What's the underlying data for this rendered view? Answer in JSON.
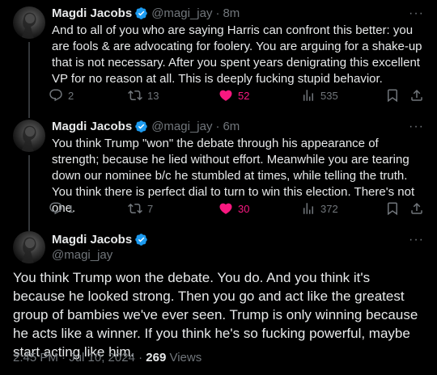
{
  "colors": {
    "background": "#000000",
    "text": "#e7e9ea",
    "muted": "#71767b",
    "verified": "#1d9bf0",
    "like": "#f91880"
  },
  "tweets": [
    {
      "name": "Magdi Jacobs",
      "handle": "@magi_jay",
      "time": "8m",
      "text": "And to all of you who are saying Harris can confront this better: you are fools & are advocating for foolery. You are arguing for a shake-up that is not necessary. After you spent years denigrating this excellent VP for no reason at all. This is deeply fucking stupid behavior.",
      "replies": "2",
      "reposts": "13",
      "likes": "52",
      "views": "535"
    },
    {
      "name": "Magdi Jacobs",
      "handle": "@magi_jay",
      "time": "6m",
      "text": "You think Trump \"won\" the debate through his appearance of strength; because he lied without effort. Meanwhile you are tearing down our nominee b/c he stumbled at times, while telling the truth. You think there is perfect dial to turn to win this election. There's not one.",
      "replies": "1",
      "reposts": "7",
      "likes": "30",
      "views": "372"
    }
  ],
  "main_tweet": {
    "name": "Magdi Jacobs",
    "handle": "@magi_jay",
    "text": "You think Trump won the debate. You do. And you think it's because he looked strong. Then you go and act like the greatest group of bambies we've ever seen. Trump is only winning because he acts like a winner. If you think he's so fucking powerful, maybe start acting like him.",
    "timestamp": "2:45 PM · Jul 10, 2024 · ",
    "views_count": "269",
    "views_label": " Views"
  },
  "icons": [
    "avatar",
    "verified-badge-icon",
    "more-icon",
    "reply-icon",
    "repost-icon",
    "like-icon",
    "views-icon",
    "bookmark-icon",
    "share-icon"
  ]
}
